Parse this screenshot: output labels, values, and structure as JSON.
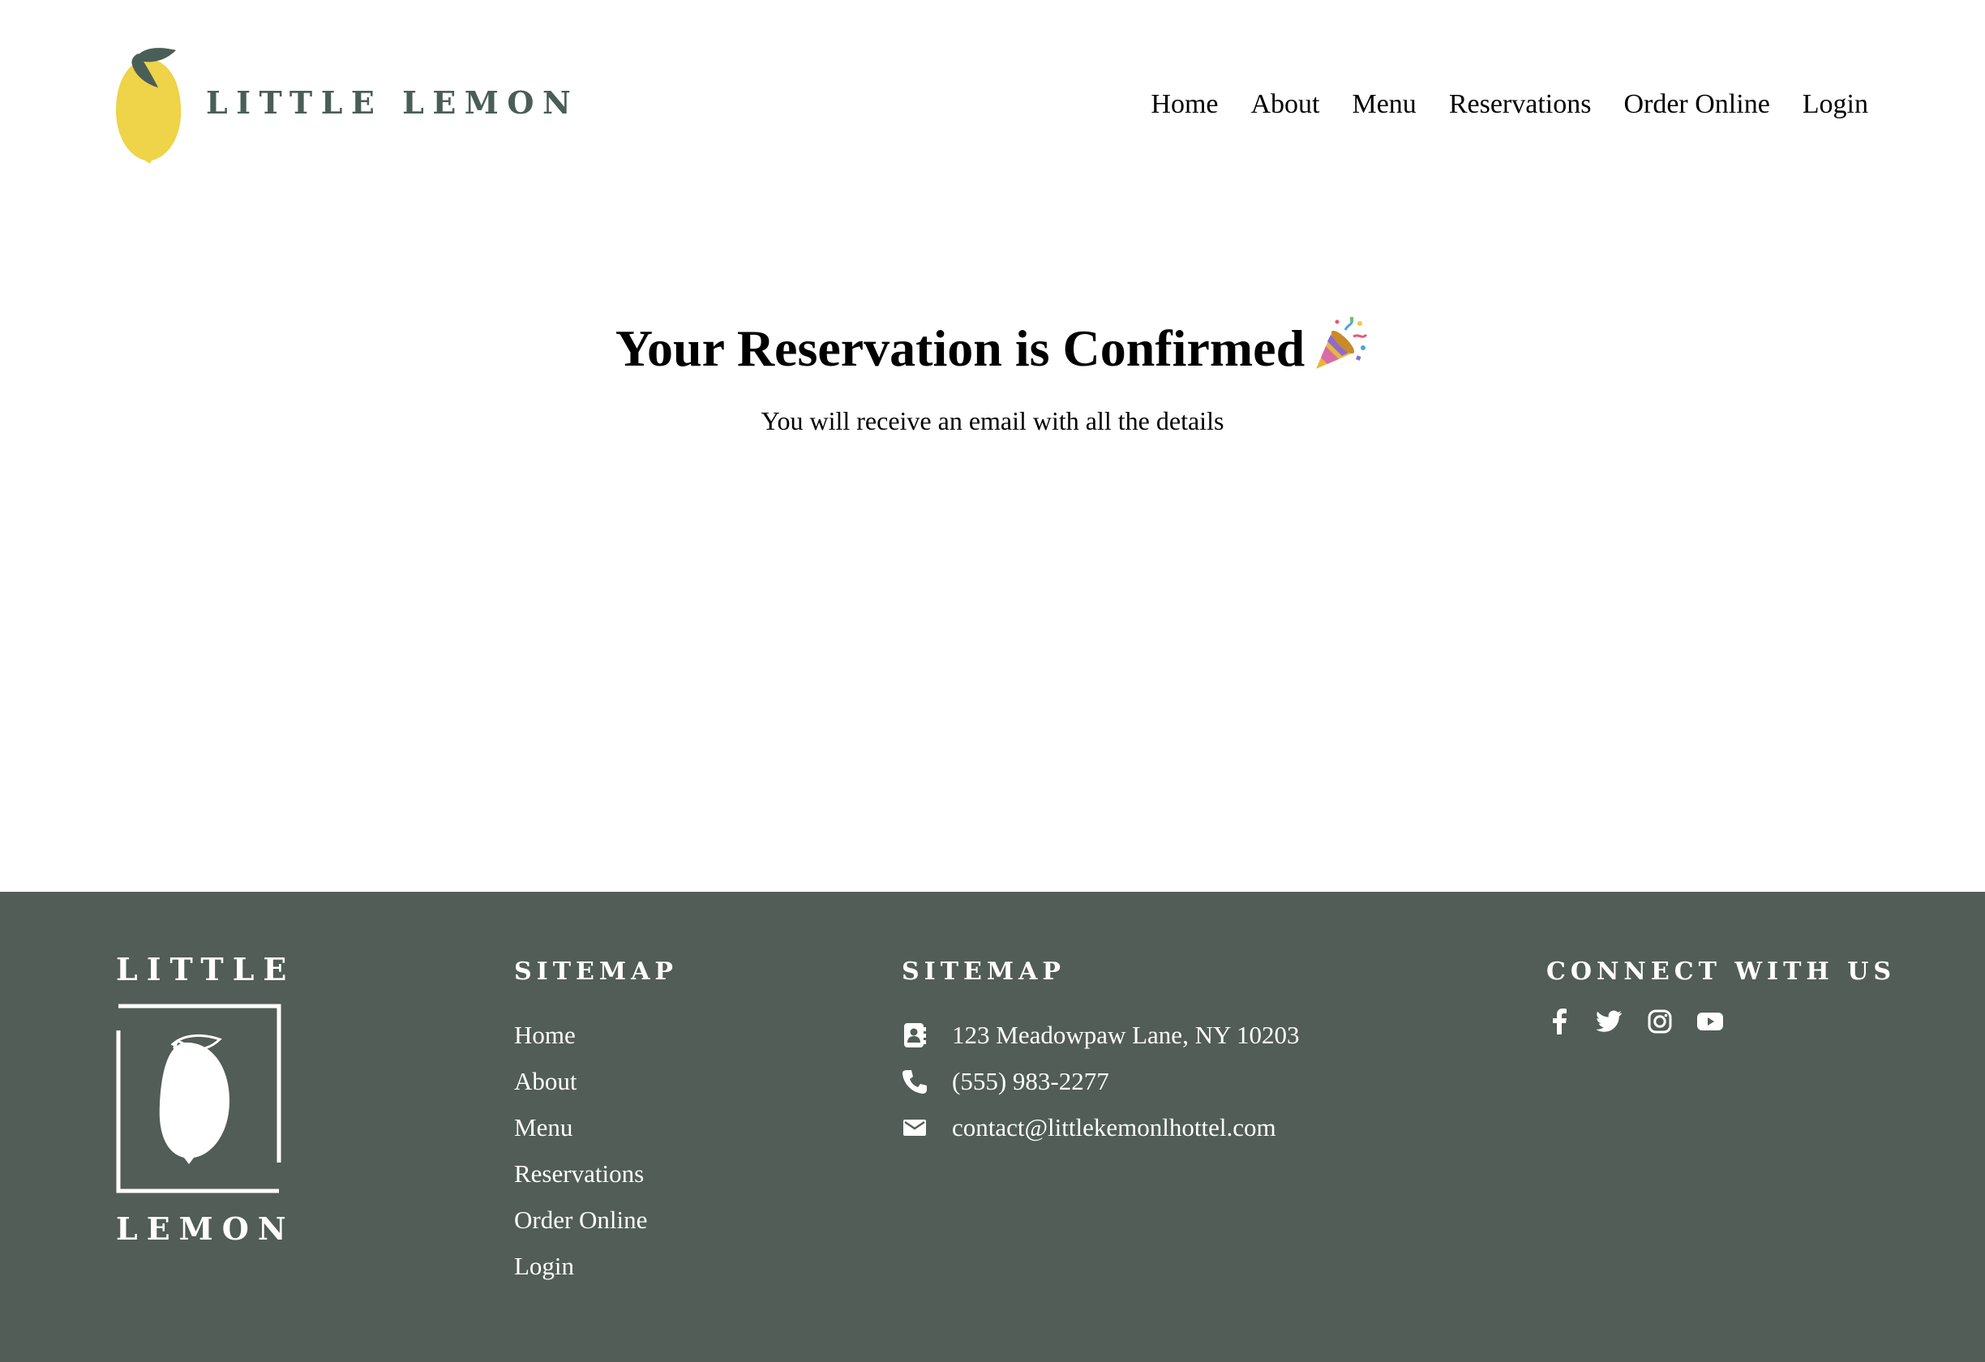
{
  "colors": {
    "footer_bg": "#515D56",
    "footer_text": "#FFFFFF",
    "brand_green": "#495E57",
    "lemon_yellow": "#EFD348"
  },
  "header": {
    "brand_name": "LITTLE LEMON",
    "nav": [
      {
        "label": "Home"
      },
      {
        "label": "About"
      },
      {
        "label": "Menu"
      },
      {
        "label": "Reservations"
      },
      {
        "label": "Order Online"
      },
      {
        "label": "Login"
      }
    ]
  },
  "confirmation": {
    "title": "Your Reservation is Confirmed",
    "title_emoji_icon": "party-popper-icon",
    "subtitle": "You will receive an email with all the details"
  },
  "footer": {
    "logo_word_top": "LITTLE",
    "logo_word_bottom": "LEMON",
    "sitemap": {
      "title": "SITEMAP",
      "links": [
        {
          "label": "Home"
        },
        {
          "label": "About"
        },
        {
          "label": "Menu"
        },
        {
          "label": "Reservations"
        },
        {
          "label": "Order Online"
        },
        {
          "label": "Login"
        }
      ]
    },
    "contact": {
      "title": "SITEMAP",
      "items": [
        {
          "icon": "address-card-icon",
          "text": "123 Meadowpaw Lane, NY 10203"
        },
        {
          "icon": "phone-icon",
          "text": "(555) 983-2277"
        },
        {
          "icon": "email-icon",
          "text": "contact@littlekemonlhottel.com"
        }
      ]
    },
    "social": {
      "title": "CONNECT WITH US",
      "icons": [
        "facebook-icon",
        "twitter-icon",
        "instagram-icon",
        "youtube-icon"
      ]
    }
  }
}
